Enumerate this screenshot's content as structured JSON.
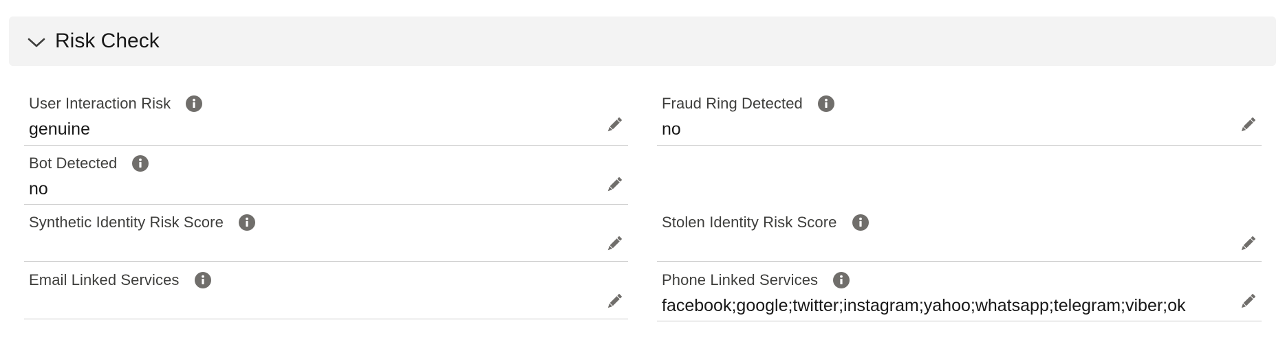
{
  "section": {
    "title": "Risk Check",
    "collapse_icon": "chevron-down-icon"
  },
  "icons": {
    "info": "info-icon",
    "edit": "pencil-icon",
    "icon_color": "#706e6b"
  },
  "fields": {
    "user_interaction_risk": {
      "label": "User Interaction Risk",
      "value": "genuine"
    },
    "fraud_ring_detected": {
      "label": "Fraud Ring Detected",
      "value": "no"
    },
    "bot_detected": {
      "label": "Bot Detected",
      "value": "no"
    },
    "synthetic_identity_risk_score": {
      "label": "Synthetic Identity Risk Score",
      "value": ""
    },
    "stolen_identity_risk_score": {
      "label": "Stolen Identity Risk Score",
      "value": ""
    },
    "email_linked_services": {
      "label": "Email Linked Services",
      "value": ""
    },
    "phone_linked_services": {
      "label": "Phone Linked Services",
      "value": "facebook;google;twitter;instagram;yahoo;whatsapp;telegram;viber;ok"
    }
  }
}
